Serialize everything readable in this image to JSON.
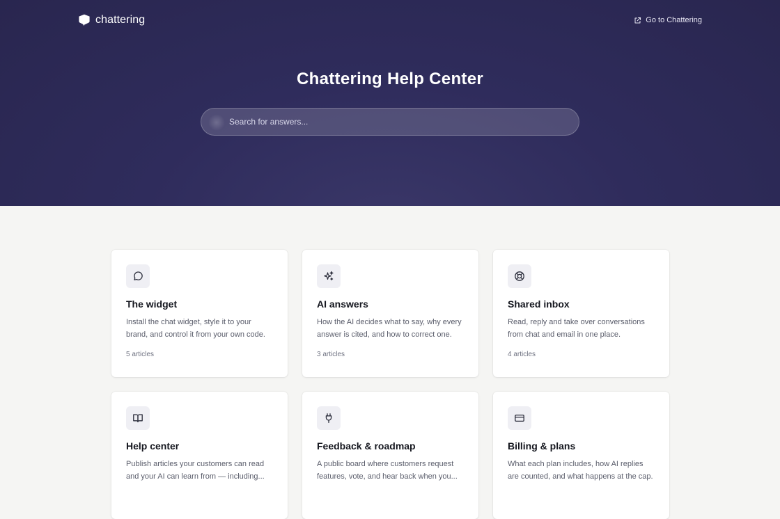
{
  "brand": {
    "name": "chattering",
    "logo_icon": "chat-bubble-logo-icon"
  },
  "topbar": {
    "goto_label": "Go to Chattering",
    "goto_icon": "external-link-icon"
  },
  "hero": {
    "title": "Chattering Help Center",
    "search_placeholder": "Search for answers...",
    "search_value": ""
  },
  "colors": {
    "hero_bg": "#2f2c5c",
    "page_bg": "#f5f5f3",
    "card_bg": "#ffffff",
    "icon_tile_bg": "#efeff4"
  },
  "categories": [
    {
      "icon": "message-bubble-icon",
      "title": "The widget",
      "description": "Install the chat widget, style it to your brand, and control it from your own code.",
      "count": "5 articles"
    },
    {
      "icon": "sparkles-icon",
      "title": "AI answers",
      "description": "How the AI decides what to say, why every answer is cited, and how to correct one.",
      "count": "3 articles"
    },
    {
      "icon": "life-buoy-icon",
      "title": "Shared inbox",
      "description": "Read, reply and take over conversations from chat and email in one place.",
      "count": "4 articles"
    },
    {
      "icon": "book-open-icon",
      "title": "Help center",
      "description": "Publish articles your customers can read and your AI can learn from — including...",
      "count": ""
    },
    {
      "icon": "plug-icon",
      "title": "Feedback & roadmap",
      "description": "A public board where customers request features, vote, and hear back when you...",
      "count": ""
    },
    {
      "icon": "credit-card-icon",
      "title": "Billing & plans",
      "description": "What each plan includes, how AI replies are counted, and what happens at the cap.",
      "count": ""
    }
  ]
}
